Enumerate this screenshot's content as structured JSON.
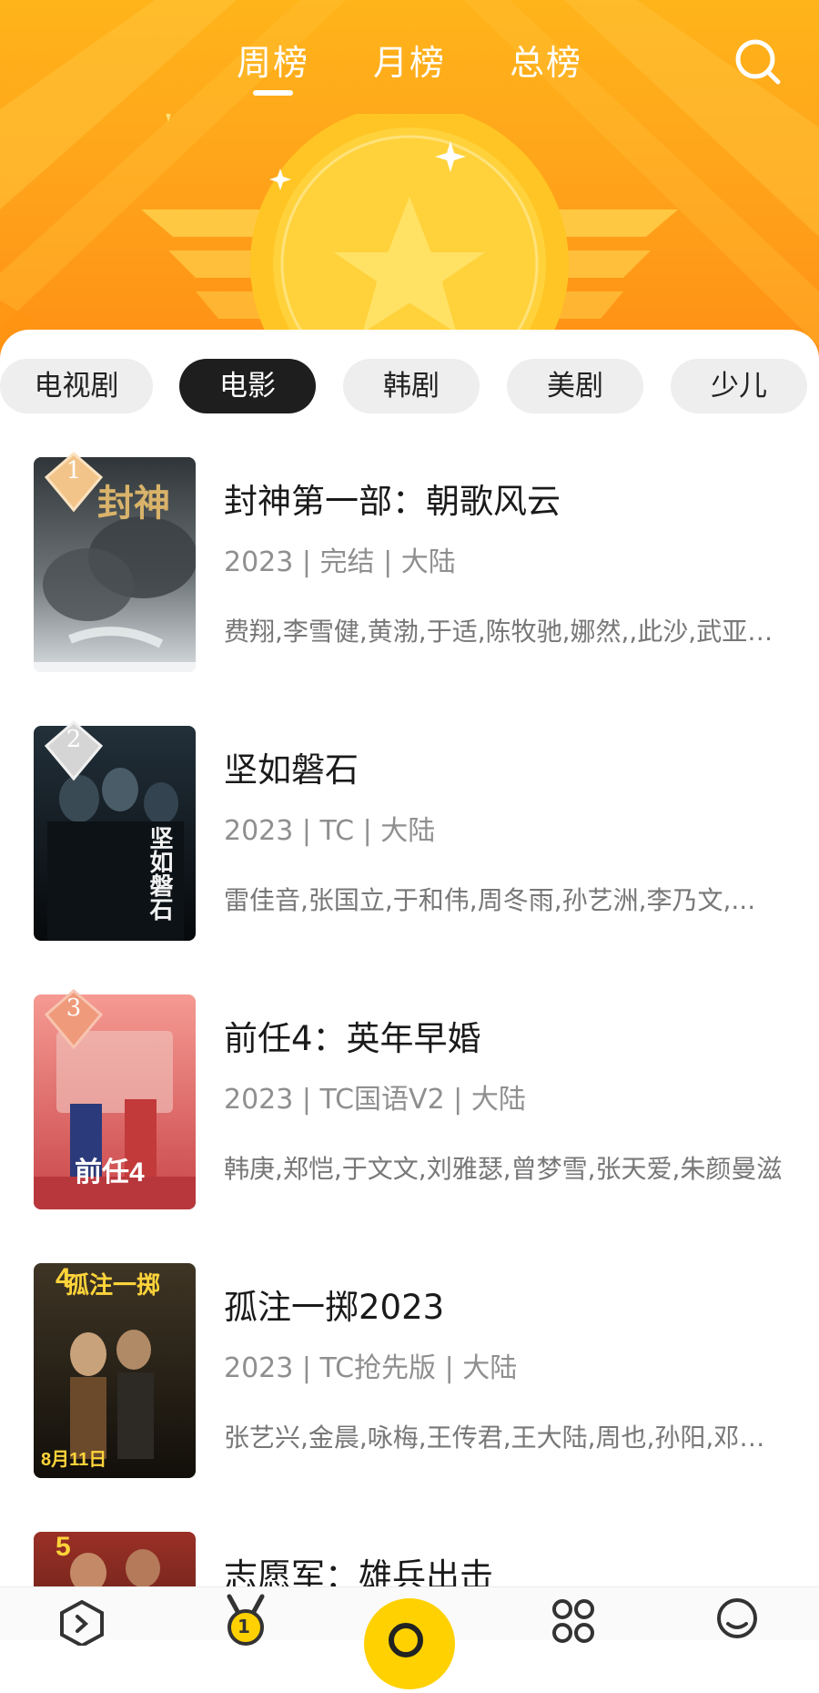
{
  "header": {
    "tabs": [
      {
        "label": "周榜",
        "active": true
      },
      {
        "label": "月榜",
        "active": false
      },
      {
        "label": "总榜",
        "active": false
      }
    ],
    "search_icon": "search-icon",
    "accent_color": "#ffa51b"
  },
  "categories": [
    {
      "label": "电视剧",
      "active": false
    },
    {
      "label": "电影",
      "active": true
    },
    {
      "label": "韩剧",
      "active": false
    },
    {
      "label": "美剧",
      "active": false
    },
    {
      "label": "少儿",
      "active": false
    }
  ],
  "items": [
    {
      "rank": "1",
      "title": "封神第一部：朝歌风云",
      "meta": "2023 | 完结 | 大陆",
      "cast": "费翔,李雪健,黄渤,于适,陈牧驰,娜然,,此沙,武亚凡,王洛勇"
    },
    {
      "rank": "2",
      "title": "坚如磐石",
      "meta": "2023 | TC | 大陆",
      "cast": "雷佳音,张国立,于和伟,周冬雨,孙艺洲,李乃文,..."
    },
    {
      "rank": "3",
      "title": "前任4：英年早婚",
      "meta": "2023 | TC国语V2 | 大陆",
      "cast": "韩庚,郑恺,于文文,刘雅瑟,曾梦雪,张天爱,朱颜曼滋"
    },
    {
      "rank": "4",
      "title": "孤注一掷2023",
      "meta": "2023 | TC抢先版 | 大陆",
      "cast": "张艺兴,金晨,咏梅,王传君,王大陆,周也,孙阳,邓家佳"
    },
    {
      "rank": "5",
      "title": "志愿军：雄兵出击",
      "meta": "",
      "cast": ""
    }
  ],
  "posters": [
    {
      "text": "封神",
      "colors": [
        "#a9b1b6",
        "#5d6468",
        "#2c2f31"
      ]
    },
    {
      "text": "坚如磐石",
      "colors": [
        "#25313a",
        "#10171c",
        "#06090b"
      ]
    },
    {
      "text": "前任4",
      "colors": [
        "#ef7d7d",
        "#d85454",
        "#b93a3f"
      ]
    },
    {
      "text": "孤注一掷",
      "colors": [
        "#4a3f2d",
        "#2a2419",
        "#151109"
      ]
    },
    {
      "text": "",
      "colors": [
        "#8e2a22",
        "#5a1b15",
        "#30100c"
      ]
    }
  ],
  "bottom_nav": {
    "icons": [
      "chevron-right-icon",
      "medal-icon",
      "search-icon",
      "apps-icon",
      "profile-icon"
    ],
    "medal_badge": "1"
  }
}
